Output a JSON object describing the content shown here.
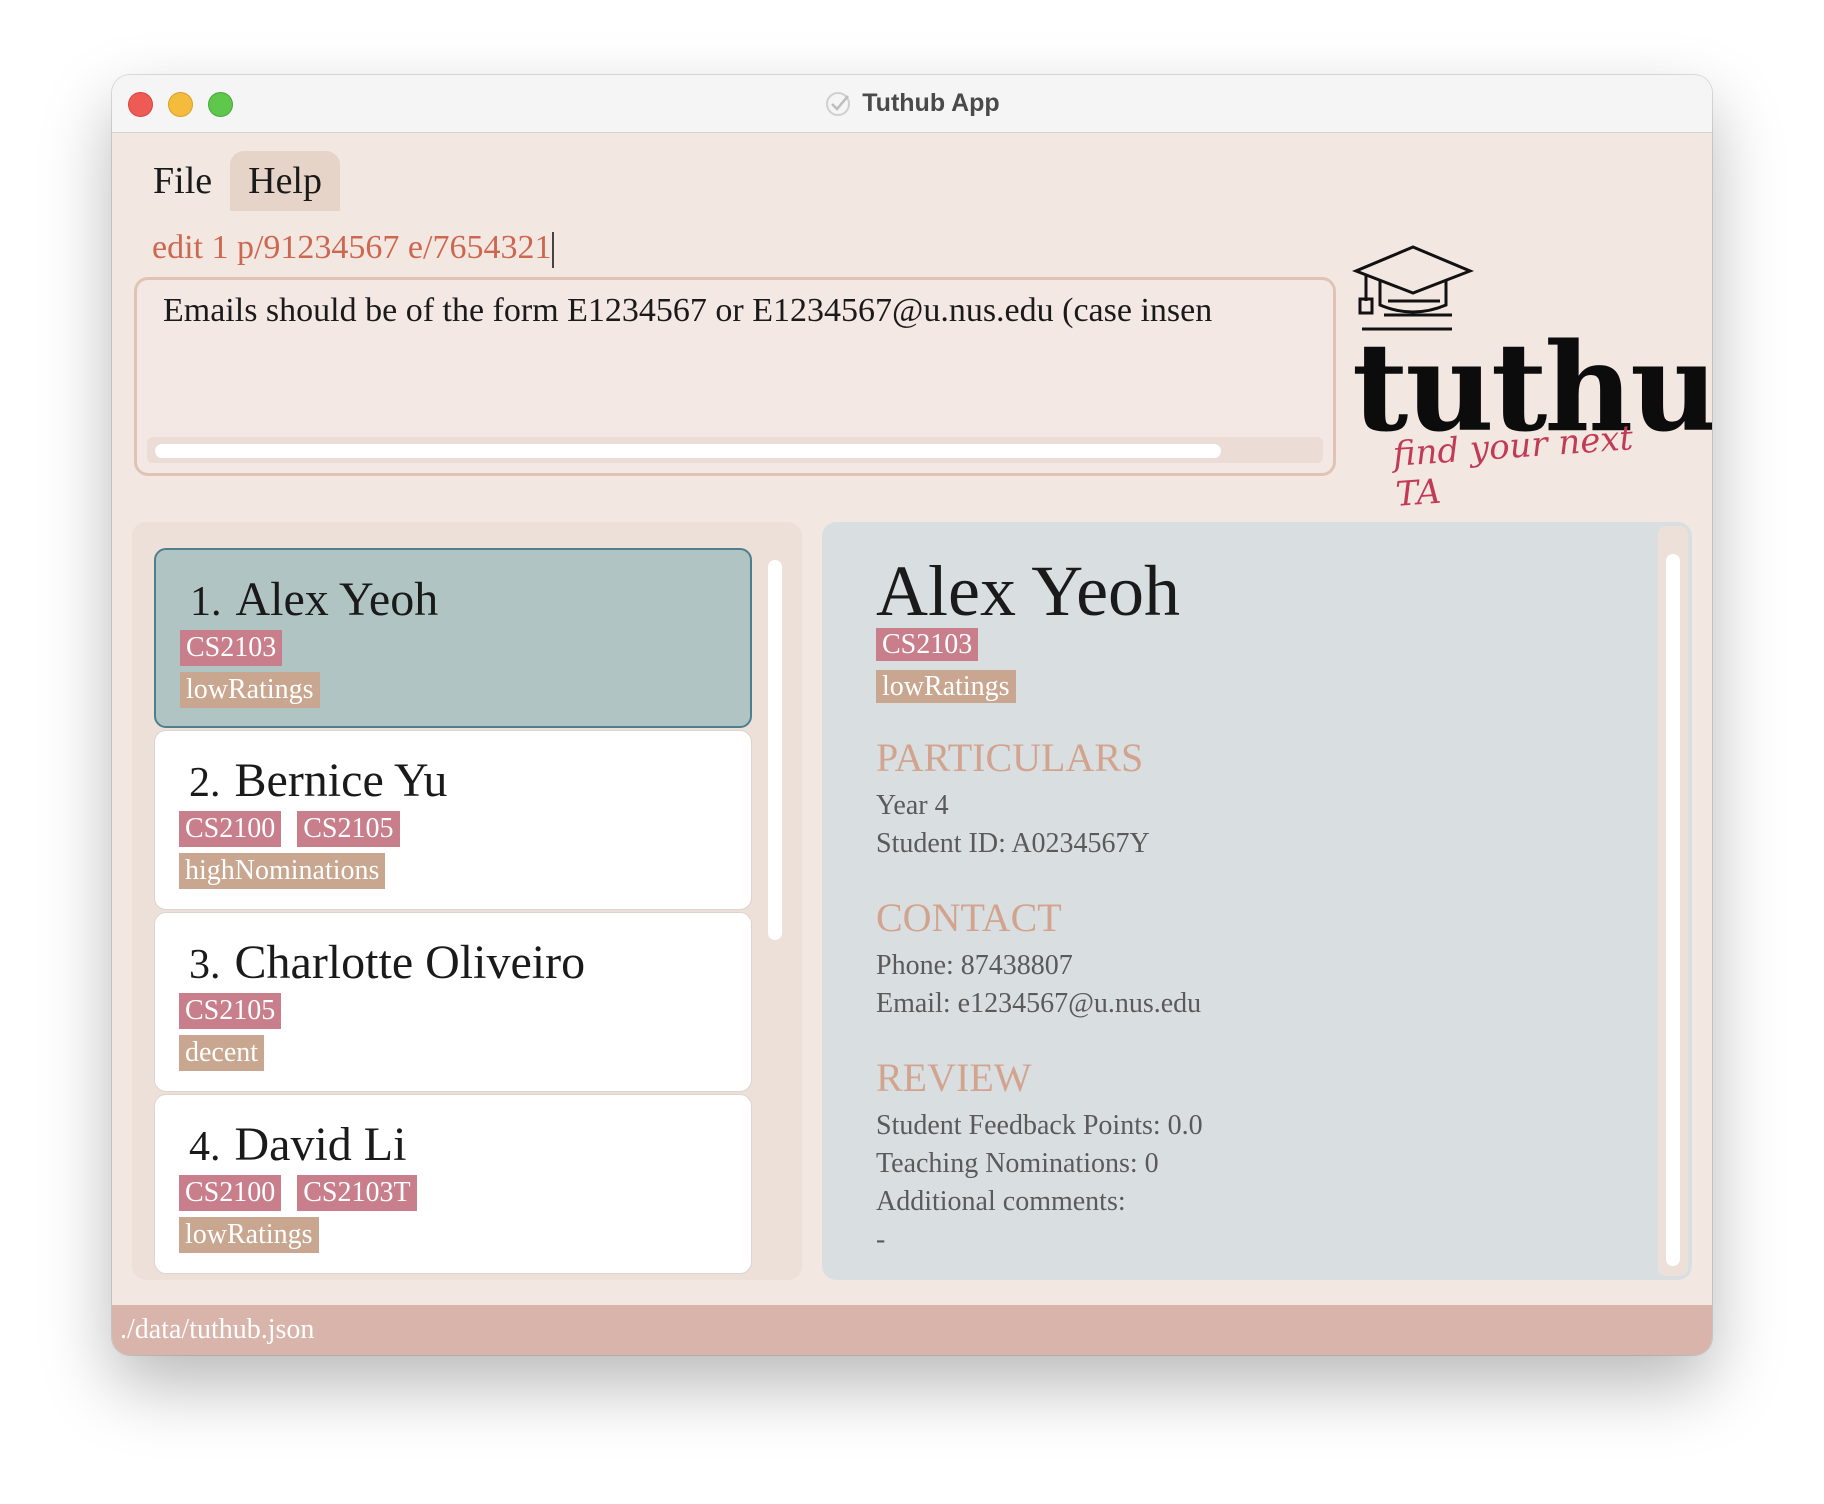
{
  "window": {
    "title": "Tuthub App"
  },
  "menu": {
    "file": "File",
    "help": "Help"
  },
  "command_input": {
    "value": "edit 1 p/91234567 e/7654321"
  },
  "result_display": {
    "text": "Emails should be of the form E1234567 or E1234567@u.nus.edu (case insen"
  },
  "logo": {
    "wordmark": "tuthub.",
    "tagline": "find your next TA"
  },
  "list": {
    "items": [
      {
        "index": "1.",
        "name": "Alex Yeoh",
        "modules": [
          "CS2103"
        ],
        "reviews": [
          "lowRatings"
        ],
        "selected": true
      },
      {
        "index": "2.",
        "name": "Bernice Yu",
        "modules": [
          "CS2100",
          "CS2105"
        ],
        "reviews": [
          "highNominations"
        ]
      },
      {
        "index": "3.",
        "name": "Charlotte Oliveiro",
        "modules": [
          "CS2105"
        ],
        "reviews": [
          "decent"
        ]
      },
      {
        "index": "4.",
        "name": "David Li",
        "modules": [
          "CS2100",
          "CS2103T"
        ],
        "reviews": [
          "lowRatings"
        ]
      }
    ]
  },
  "detail": {
    "name": "Alex Yeoh",
    "module_tag": "CS2103",
    "review_tag": "lowRatings",
    "particulars_heading": "PARTICULARS",
    "year": "Year 4",
    "student_id": "Student ID: A0234567Y",
    "contact_heading": "CONTACT",
    "phone": "Phone: 87438807",
    "email": "Email: e1234567@u.nus.edu",
    "review_heading": "REVIEW",
    "feedback_points": "Student Feedback Points: 0.0",
    "nominations": "Teaching Nominations: 0",
    "comments_label": "Additional comments:",
    "comments_value": "-"
  },
  "status_bar": {
    "path": "./data/tuthub.json"
  },
  "colors": {
    "background": "#f3e7e2",
    "module_tag": "#c87e8b",
    "review_tag": "#c8a68f",
    "selected_card": "#b0c5c3",
    "section_heading": "#d2a48f",
    "command_text": "#cd6850",
    "status_bar": "#d8b4ab"
  },
  "icons": {
    "app_icon": "checkmark-icon",
    "logo_icon": "graduation-cap-icon"
  }
}
